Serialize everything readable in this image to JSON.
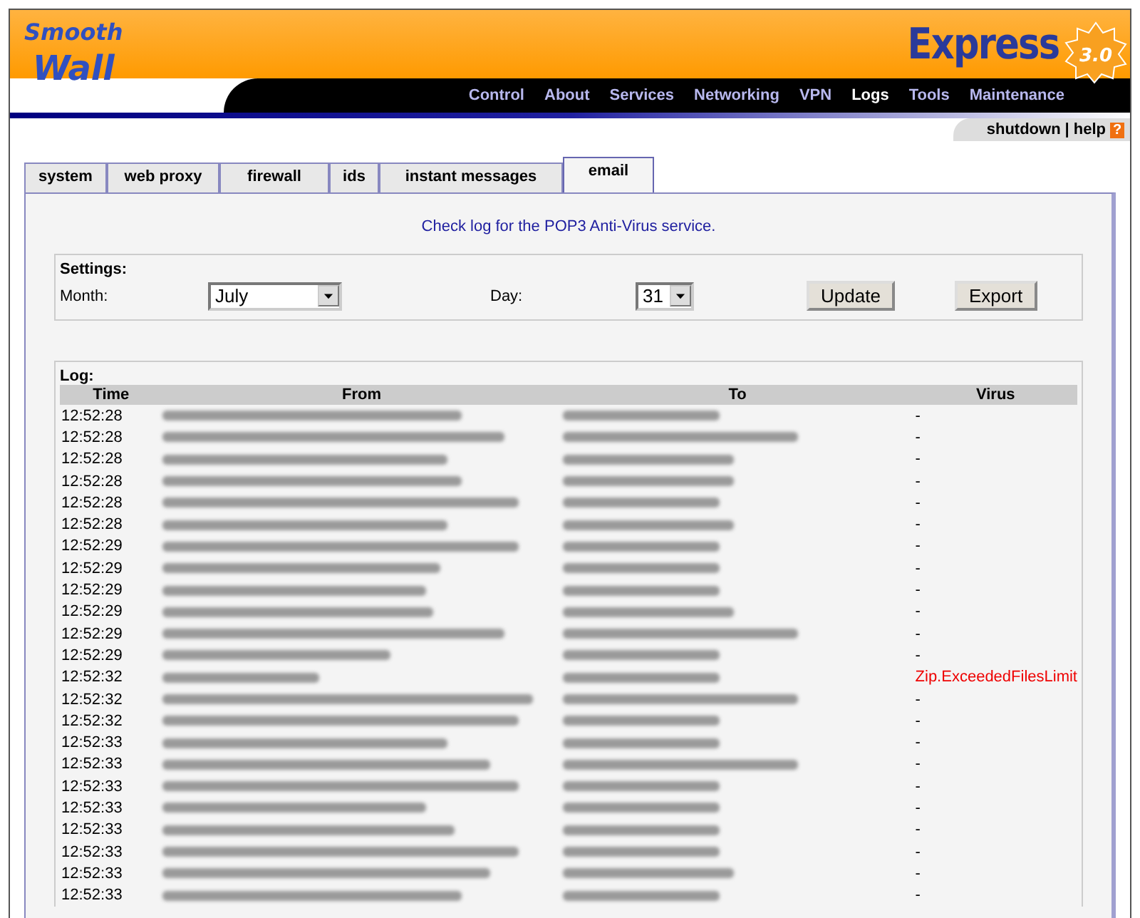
{
  "header": {
    "logo": [
      "Smooth",
      "Wall"
    ],
    "product": "Express",
    "version": "3.0",
    "nav": [
      {
        "label": "Control",
        "selected": false
      },
      {
        "label": "About",
        "selected": false
      },
      {
        "label": "Services",
        "selected": false
      },
      {
        "label": "Networking",
        "selected": false
      },
      {
        "label": "VPN",
        "selected": false
      },
      {
        "label": "Logs",
        "selected": true
      },
      {
        "label": "Tools",
        "selected": false
      },
      {
        "label": "Maintenance",
        "selected": false
      }
    ],
    "links": [
      "shutdown",
      "help"
    ],
    "link_separator": "|",
    "help_icon": "?"
  },
  "tabs": [
    {
      "label": "system",
      "selected": false
    },
    {
      "label": "web proxy",
      "selected": false
    },
    {
      "label": "firewall",
      "selected": false
    },
    {
      "label": "ids",
      "selected": false
    },
    {
      "label": "instant messages",
      "selected": false
    },
    {
      "label": "email",
      "selected": true
    }
  ],
  "intro": "Check log for the POP3 Anti-Virus service.",
  "settings": {
    "title": "Settings:",
    "month_label": "Month:",
    "month": "July",
    "day_label": "Day:",
    "day": "31",
    "buttons": [
      "Update",
      "Export"
    ]
  },
  "log": {
    "title": "Log:",
    "columns": [
      "Time",
      "From",
      "To",
      "Virus"
    ],
    "rows": [
      {
        "time": "12:52:28",
        "virus": "-",
        "infected": false
      },
      {
        "time": "12:52:28",
        "virus": "-",
        "infected": false
      },
      {
        "time": "12:52:28",
        "virus": "-",
        "infected": false
      },
      {
        "time": "12:52:28",
        "virus": "-",
        "infected": false
      },
      {
        "time": "12:52:28",
        "virus": "-",
        "infected": false
      },
      {
        "time": "12:52:28",
        "virus": "-",
        "infected": false
      },
      {
        "time": "12:52:29",
        "virus": "-",
        "infected": false
      },
      {
        "time": "12:52:29",
        "virus": "-",
        "infected": false
      },
      {
        "time": "12:52:29",
        "virus": "-",
        "infected": false
      },
      {
        "time": "12:52:29",
        "virus": "-",
        "infected": false
      },
      {
        "time": "12:52:29",
        "virus": "-",
        "infected": false
      },
      {
        "time": "12:52:29",
        "virus": "-",
        "infected": false
      },
      {
        "time": "12:52:32",
        "virus": "Zip.ExceededFilesLimit",
        "infected": true
      },
      {
        "time": "12:52:32",
        "virus": "-",
        "infected": false
      },
      {
        "time": "12:52:32",
        "virus": "-",
        "infected": false
      },
      {
        "time": "12:52:33",
        "virus": "-",
        "infected": false
      },
      {
        "time": "12:52:33",
        "virus": "-",
        "infected": false
      },
      {
        "time": "12:52:33",
        "virus": "-",
        "infected": false
      },
      {
        "time": "12:52:33",
        "virus": "-",
        "infected": false
      },
      {
        "time": "12:52:33",
        "virus": "-",
        "infected": false
      },
      {
        "time": "12:52:33",
        "virus": "-",
        "infected": false
      },
      {
        "time": "12:52:33",
        "virus": "-",
        "infected": false
      },
      {
        "time": "12:52:33",
        "virus": "-",
        "infected": false
      }
    ]
  }
}
